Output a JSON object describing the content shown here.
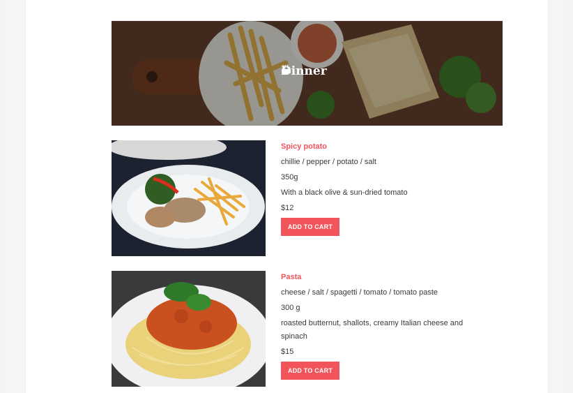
{
  "banner": {
    "title": "Dinner",
    "icon": "coffee-cup-icon"
  },
  "menu_items": [
    {
      "name": "Spicy potato",
      "ingredients": "chillie / pepper / potato / salt",
      "weight": "350g",
      "description": "With a black olive & sun-dried tomato",
      "price": "$12",
      "button": "ADD TO CART"
    },
    {
      "name": "Pasta",
      "ingredients": "cheese / salt / spagetti / tomato / tomato paste",
      "weight": "300 g",
      "description": "roasted butternut, shallots, creamy Italian cheese and spinach",
      "price": "$15",
      "button": "ADD TO CART"
    }
  ],
  "colors": {
    "accent": "#f2545b",
    "text": "#3a3a3a"
  }
}
